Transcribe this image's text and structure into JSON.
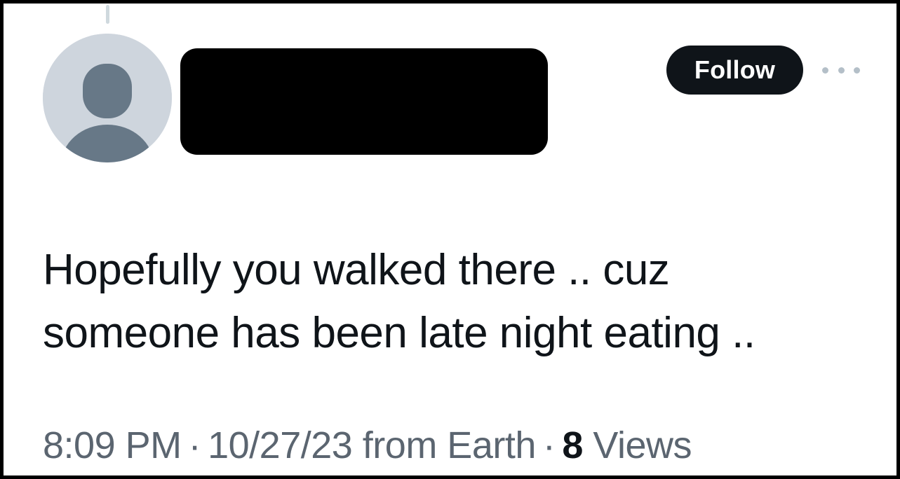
{
  "tweet": {
    "follow_label": "Follow",
    "more_icon": "more-horizontal-icon",
    "avatar_icon": "default-profile-icon",
    "text_lines": [
      "Hopefully you walked there .. cuz",
      "someone has been late night eating .."
    ],
    "meta": {
      "time": "8:09 PM",
      "separator": "·",
      "date": "10/27/23 from Earth",
      "views_count": "8",
      "views_label": "Views"
    }
  },
  "colors": {
    "follow_background": "#0f1419",
    "text_primary": "#0f1419",
    "text_secondary": "#5b6570",
    "avatar_background": "#ced5dd",
    "avatar_figure": "#677887",
    "redaction": "#000000"
  }
}
